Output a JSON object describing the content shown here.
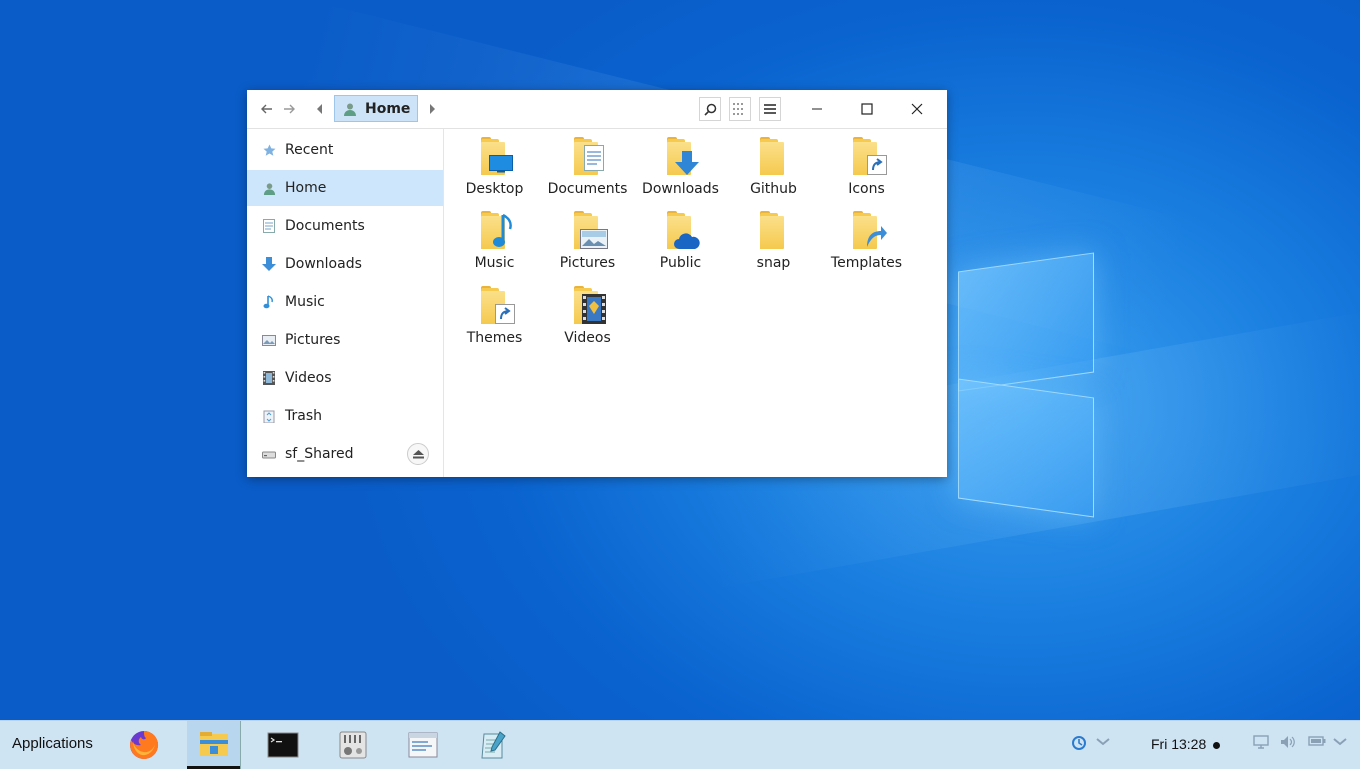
{
  "window": {
    "breadcrumb": "Home"
  },
  "sidebar": {
    "items": [
      {
        "label": "Recent",
        "icon": "star-icon"
      },
      {
        "label": "Home",
        "icon": "home-user-icon",
        "selected": true
      },
      {
        "label": "Documents",
        "icon": "document-icon"
      },
      {
        "label": "Downloads",
        "icon": "download-arrow-icon"
      },
      {
        "label": "Music",
        "icon": "music-note-icon"
      },
      {
        "label": "Pictures",
        "icon": "picture-icon"
      },
      {
        "label": "Videos",
        "icon": "film-icon"
      },
      {
        "label": "Trash",
        "icon": "trash-icon"
      },
      {
        "label": "sf_Shared",
        "icon": "drive-icon",
        "ejectable": true
      }
    ]
  },
  "files": [
    {
      "label": "Desktop",
      "emblem": "monitor"
    },
    {
      "label": "Documents",
      "emblem": "document"
    },
    {
      "label": "Downloads",
      "emblem": "download"
    },
    {
      "label": "Github",
      "emblem": "none"
    },
    {
      "label": "Icons",
      "emblem": "link"
    },
    {
      "label": "Music",
      "emblem": "music"
    },
    {
      "label": "Pictures",
      "emblem": "picture"
    },
    {
      "label": "Public",
      "emblem": "cloud"
    },
    {
      "label": "snap",
      "emblem": "none"
    },
    {
      "label": "Templates",
      "emblem": "arrow"
    },
    {
      "label": "Themes",
      "emblem": "link"
    },
    {
      "label": "Videos",
      "emblem": "film"
    }
  ],
  "taskbar": {
    "applications_label": "Applications",
    "apps": [
      "firefox-icon",
      "file-manager-icon",
      "terminal-icon",
      "settings-icon",
      "system-monitor-icon",
      "text-editor-icon"
    ],
    "clock": "Fri 13:28"
  },
  "colors": {
    "accent": "#cde6fb",
    "desktop": "#0a63cf",
    "folder": "#f6c94f"
  }
}
